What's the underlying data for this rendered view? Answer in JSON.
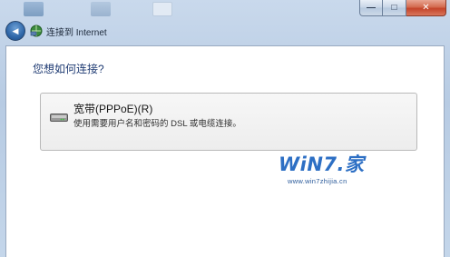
{
  "window": {
    "nav_title": "连接到 Internet",
    "minimize_glyph": "—",
    "maximize_glyph": "□",
    "close_glyph": "✕",
    "back_glyph": "◀"
  },
  "content": {
    "question": "您想如何连接?",
    "options": [
      {
        "title": "宽带(PPPoE)(R)",
        "description": "使用需要用户名和密码的 DSL 或电缆连接。",
        "icon": "modem-icon"
      }
    ]
  },
  "watermark": {
    "logo": "WiN7.家",
    "url": "www.win7zhijia.cn"
  },
  "colors": {
    "question_text": "#1f3b73",
    "frame": "#c4d6ea",
    "watermark_blue": "#2d6fc4",
    "close_red": "#c4442a"
  }
}
